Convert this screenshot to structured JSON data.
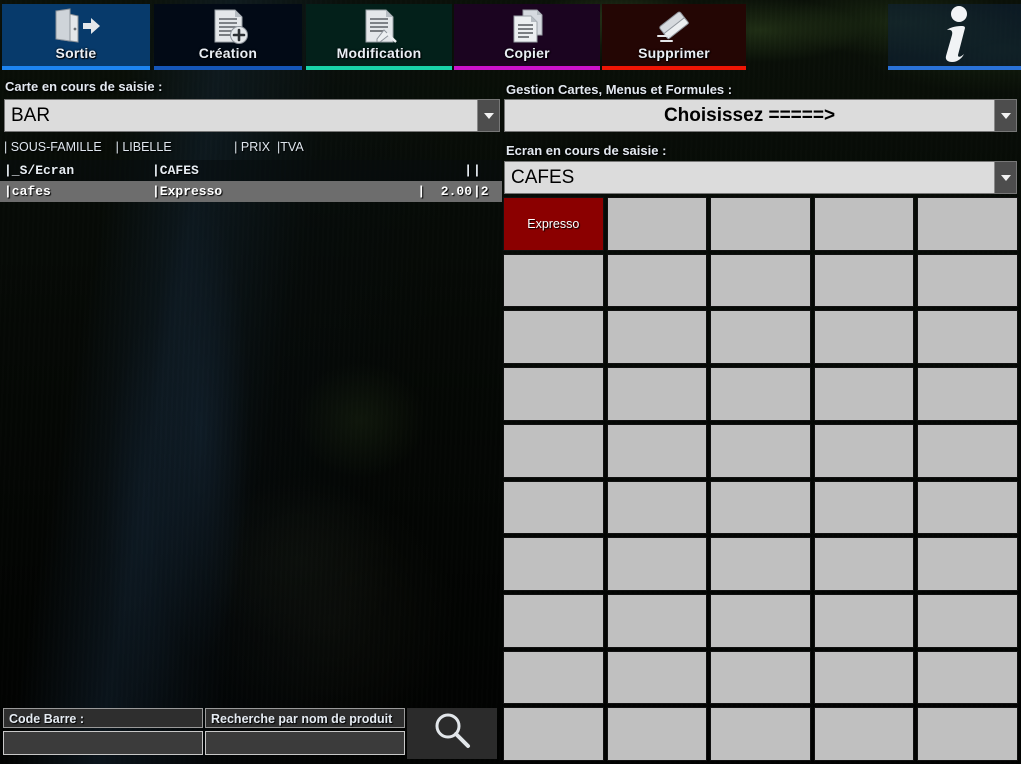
{
  "toolbar": {
    "buttons": [
      {
        "id": "sortie",
        "label": "Sortie",
        "icon": "exit-door-icon",
        "accent": "#1d84f0",
        "bg": "#073a6b"
      },
      {
        "id": "creation",
        "label": "Création",
        "icon": "document-add-icon",
        "accent": "#1556b8",
        "bg": "#020a16"
      },
      {
        "id": "modification",
        "label": "Modification",
        "icon": "document-edit-icon",
        "accent": "#19d2a8",
        "bg": "#03201a"
      },
      {
        "id": "copier",
        "label": "Copier",
        "icon": "document-copy-icon",
        "accent": "#cc12cc",
        "bg": "#1b0420"
      },
      {
        "id": "supprimer",
        "label": "Supprimer",
        "icon": "eraser-icon",
        "accent": "#f01505",
        "bg": "#240604"
      },
      {
        "id": "info",
        "label": "",
        "icon": "info-icon",
        "accent": "#2a72d8",
        "bg": "rgba(14,34,58,.55)"
      }
    ]
  },
  "left": {
    "carte_label": "Carte en cours de saisie :",
    "carte_value": "BAR",
    "columns_line": "| SOUS-FAMILLE    | LIBELLE                  | PRIX  |TVA",
    "columns": [
      "| SOUS-FAMILLE",
      "| LIBELLE",
      "| PRIX",
      "|TVA"
    ],
    "rows": [
      {
        "sous_famille": "|_S/Ecran",
        "libelle": "|CAFES",
        "prix": "|",
        "tva": "|",
        "type": "group",
        "selected": false
      },
      {
        "sous_famille": "|cafes",
        "libelle": "|Expresso",
        "prix": "|  2.00",
        "tva": "|2",
        "type": "item",
        "selected": true
      }
    ],
    "search": {
      "code_barre_label": "Code Barre :",
      "code_barre_value": "",
      "code_barre_placeholder": "",
      "nom_label": "Recherche par nom de produit",
      "nom_value": "",
      "nom_placeholder": "",
      "button_icon": "magnifier-icon"
    }
  },
  "right": {
    "gestion_label": "Gestion Cartes, Menus et Formules  :",
    "gestion_value": "Choisissez  =====>",
    "ecran_label": "Ecran en cours de saisie :",
    "ecran_value": "CAFES",
    "grid": {
      "columns": 5,
      "rows": 10,
      "cells": [
        "Expresso",
        "",
        "",
        "",
        "",
        "",
        "",
        "",
        "",
        "",
        "",
        "",
        "",
        "",
        "",
        "",
        "",
        "",
        "",
        "",
        "",
        "",
        "",
        "",
        "",
        "",
        "",
        "",
        "",
        "",
        "",
        "",
        "",
        "",
        "",
        "",
        "",
        "",
        "",
        "",
        "",
        "",
        "",
        "",
        "",
        "",
        "",
        "",
        "",
        ""
      ],
      "active_index": 0,
      "active_color": "#8b0000",
      "empty_color": "#c0c0c0"
    }
  }
}
